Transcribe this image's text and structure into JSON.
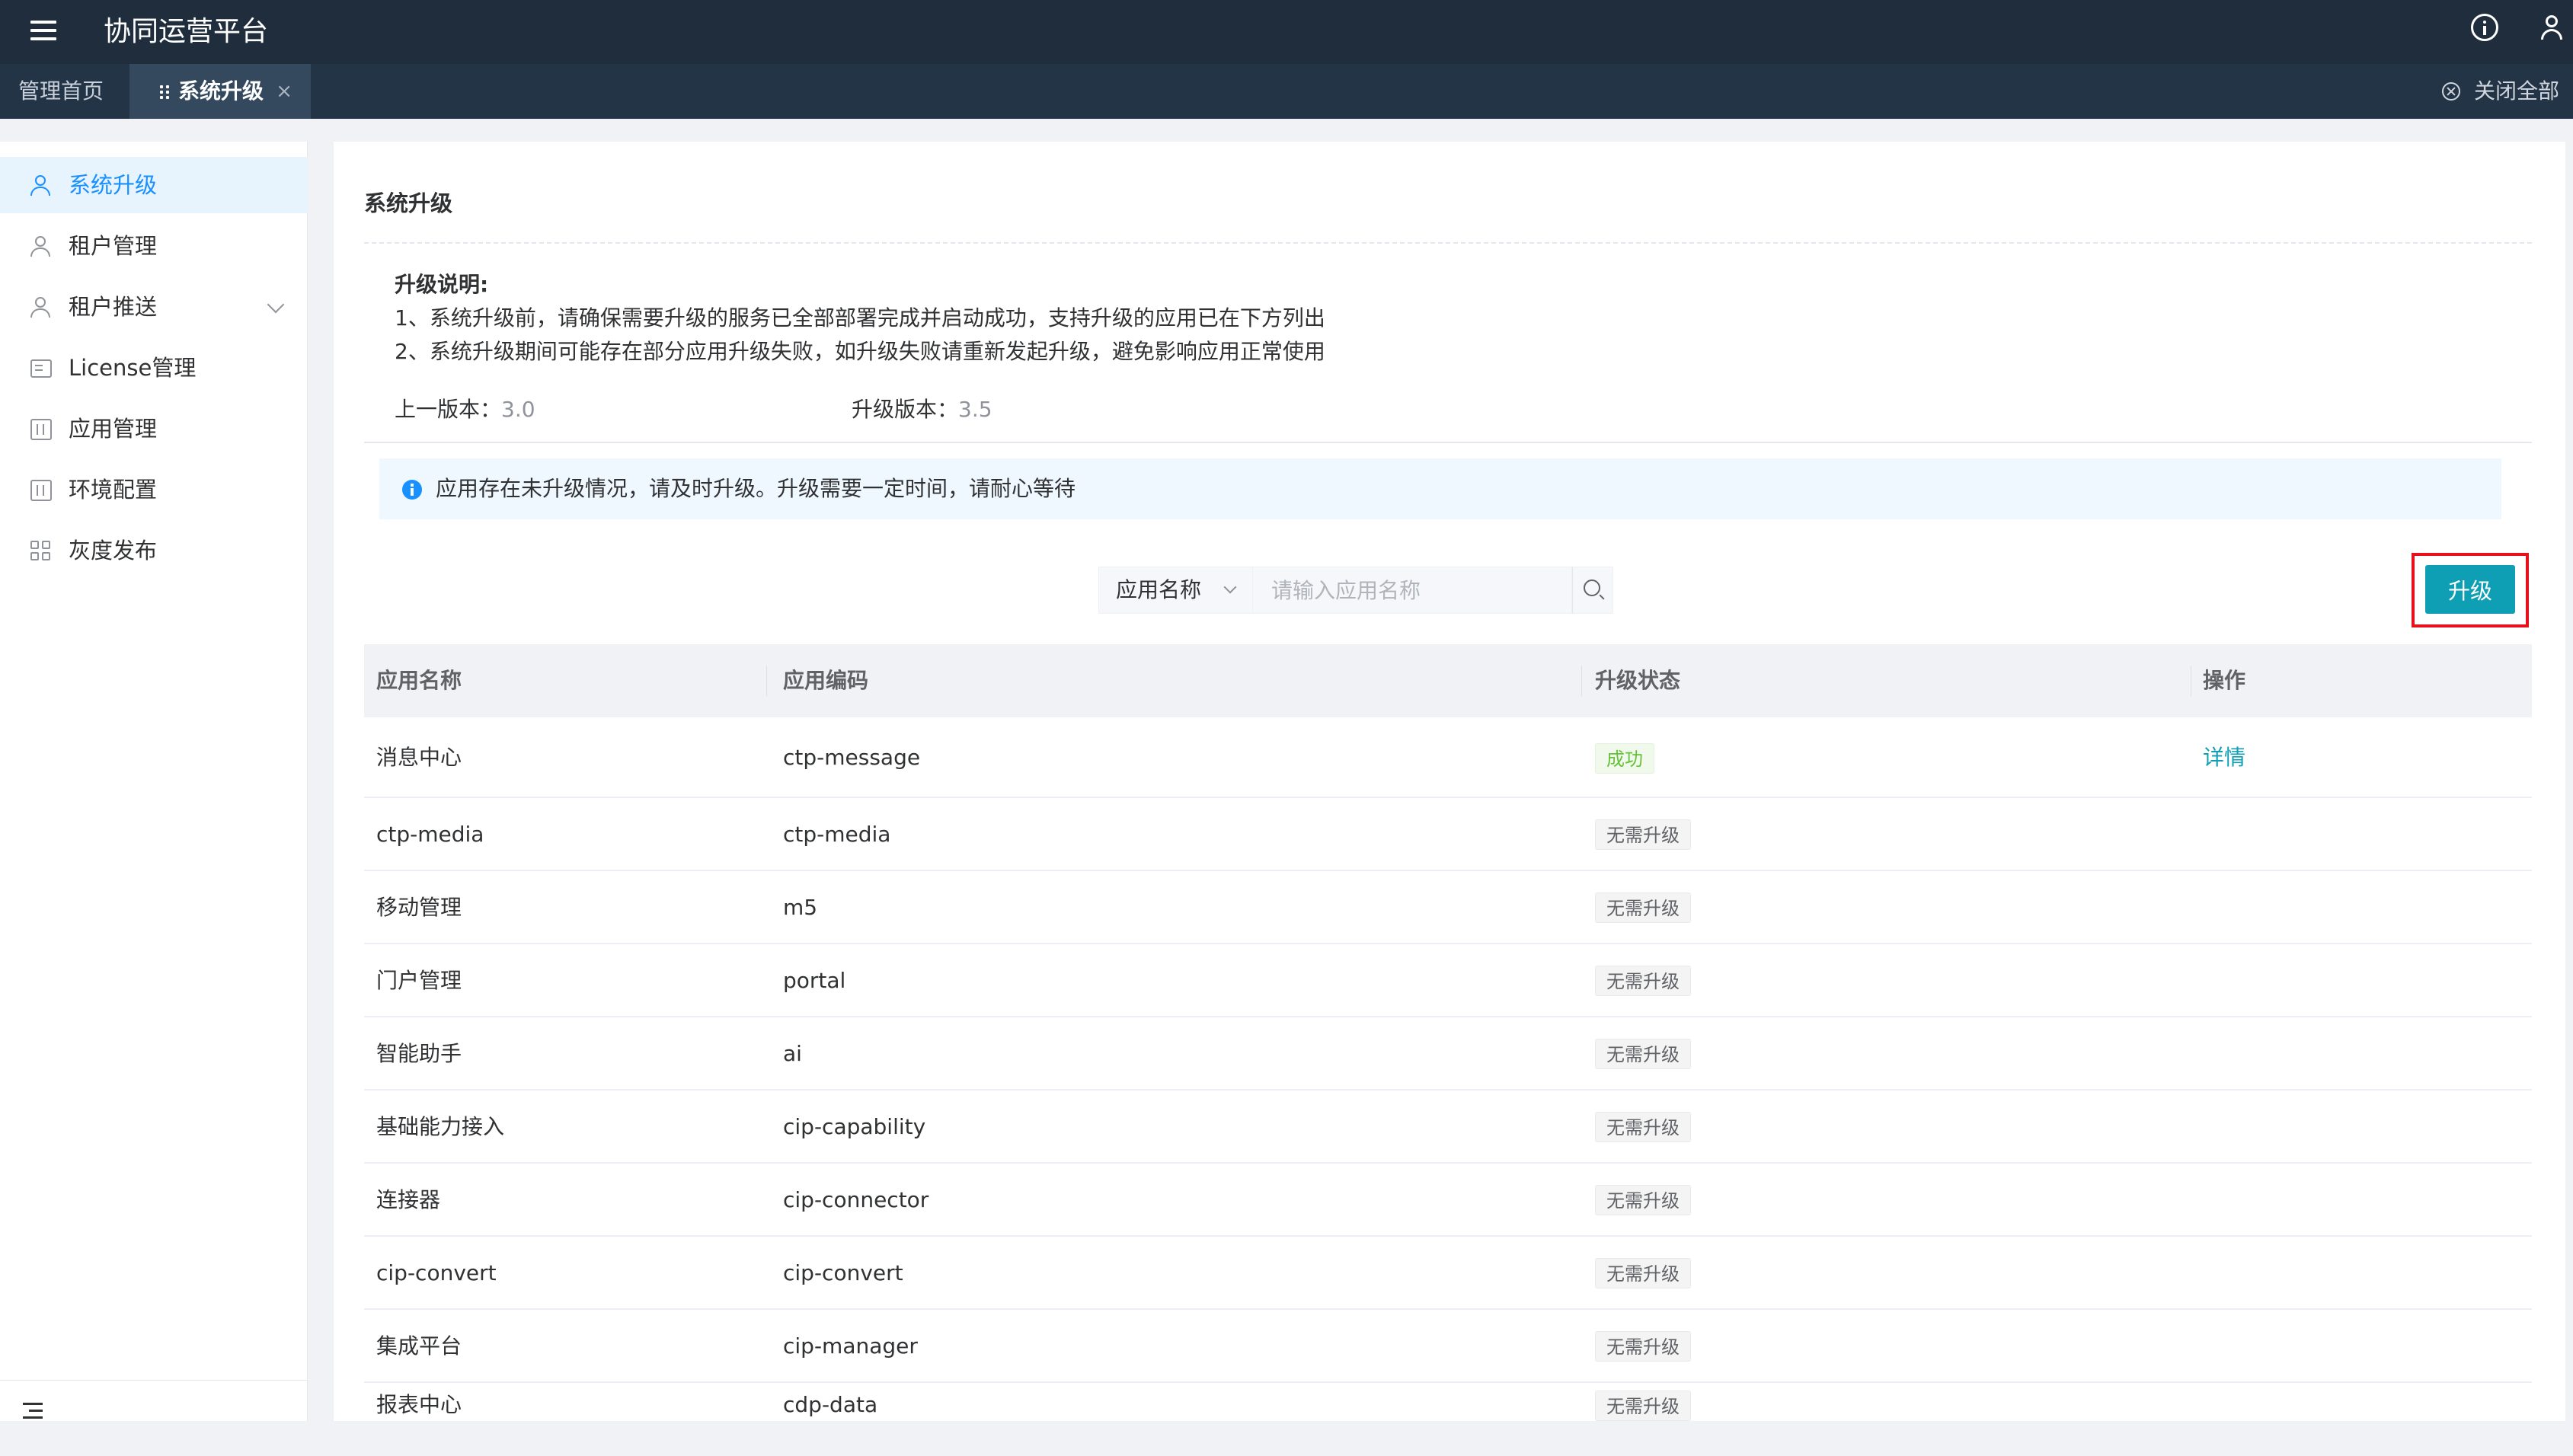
{
  "header": {
    "app_title": "协同运营平台"
  },
  "tabs": {
    "home": "管理首页",
    "active": "系统升级",
    "close_symbol": "×",
    "close_all": "关闭全部"
  },
  "sidebar": {
    "items": [
      {
        "label": "系统升级",
        "icon": "users-icon",
        "active": true
      },
      {
        "label": "租户管理",
        "icon": "users-icon"
      },
      {
        "label": "租户推送",
        "icon": "users-icon",
        "expandable": true
      },
      {
        "label": "License管理",
        "icon": "card-icon"
      },
      {
        "label": "应用管理",
        "icon": "box-icon"
      },
      {
        "label": "环境配置",
        "icon": "box-icon"
      },
      {
        "label": "灰度发布",
        "icon": "grid-icon"
      }
    ]
  },
  "main": {
    "title": "系统升级",
    "desc_title": "升级说明:",
    "desc_lines": [
      "1、系统升级前，请确保需要升级的服务已全部部署完成并启动成功，支持升级的应用已在下方列出",
      "2、系统升级期间可能存在部分应用升级失败，如升级失败请重新发起升级，避免影响应用正常使用"
    ],
    "prev_version_label": "上一版本：",
    "prev_version": "3.0",
    "target_version_label": "升级版本：",
    "target_version": "3.5",
    "alert": "应用存在未升级情况，请及时升级。升级需要一定时间，请耐心等待",
    "search_field": "应用名称",
    "search_placeholder": "请输入应用名称",
    "upgrade_button": "升级",
    "columns": [
      "应用名称",
      "应用编码",
      "升级状态",
      "操作"
    ],
    "rows": [
      {
        "name": "消息中心",
        "code": "ctp-message",
        "status": "成功",
        "status_type": "success",
        "action": "详情"
      },
      {
        "name": "ctp-media",
        "code": "ctp-media",
        "status": "无需升级",
        "status_type": "none",
        "action": ""
      },
      {
        "name": "移动管理",
        "code": "m5",
        "status": "无需升级",
        "status_type": "none",
        "action": ""
      },
      {
        "name": "门户管理",
        "code": "portal",
        "status": "无需升级",
        "status_type": "none",
        "action": ""
      },
      {
        "name": "智能助手",
        "code": "ai",
        "status": "无需升级",
        "status_type": "none",
        "action": ""
      },
      {
        "name": "基础能力接入",
        "code": "cip-capability",
        "status": "无需升级",
        "status_type": "none",
        "action": ""
      },
      {
        "name": "连接器",
        "code": "cip-connector",
        "status": "无需升级",
        "status_type": "none",
        "action": ""
      },
      {
        "name": "cip-convert",
        "code": "cip-convert",
        "status": "无需升级",
        "status_type": "none",
        "action": ""
      },
      {
        "name": "集成平台",
        "code": "cip-manager",
        "status": "无需升级",
        "status_type": "none",
        "action": ""
      },
      {
        "name": "报表中心",
        "code": "cdp-data",
        "status": "无需升级",
        "status_type": "none",
        "action": ""
      }
    ]
  },
  "colors": {
    "header_bg": "#1f2d3d",
    "tabs_bg": "#243447",
    "accent": "#0f9fb5",
    "active_nav": "#1890ff",
    "highlight": "#e8101b"
  }
}
